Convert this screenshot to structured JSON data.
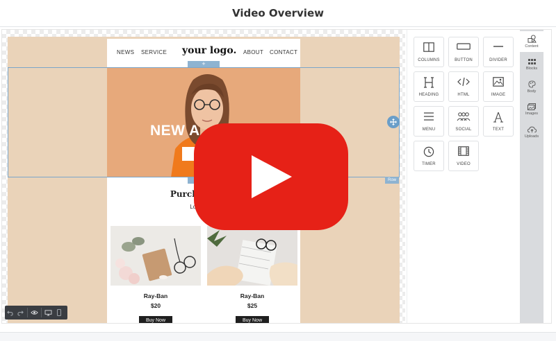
{
  "header": {
    "title": "Video Overview"
  },
  "email": {
    "nav": {
      "left": [
        "NEWS",
        "SERVICE"
      ],
      "logo": "your logo.",
      "right": [
        "ABOUT",
        "CONTACT"
      ]
    },
    "hero": {
      "title": "NEW A",
      "button": "VI"
    },
    "section": {
      "title": "Purchasing Fo",
      "subtitle": "Lorem ipsu"
    },
    "products": [
      {
        "name": "Ray-Ban",
        "price": "$20",
        "button": "Buy Now"
      },
      {
        "name": "Ray-Ban",
        "price": "$25",
        "button": "Buy Now"
      }
    ]
  },
  "editor": {
    "add_symbol": "+",
    "row_label": "Row"
  },
  "tools": [
    {
      "label": "COLUMNS",
      "icon": "columns-icon"
    },
    {
      "label": "BUTTON",
      "icon": "button-icon"
    },
    {
      "label": "DIVIDER",
      "icon": "divider-icon"
    },
    {
      "label": "HEADING",
      "icon": "heading-icon"
    },
    {
      "label": "HTML",
      "icon": "code-icon"
    },
    {
      "label": "IMAGE",
      "icon": "image-icon"
    },
    {
      "label": "MENU",
      "icon": "menu-icon"
    },
    {
      "label": "SOCIAL",
      "icon": "social-icon"
    },
    {
      "label": "TEXT",
      "icon": "text-icon"
    },
    {
      "label": "TIMER",
      "icon": "clock-icon"
    },
    {
      "label": "VIDEO",
      "icon": "film-icon"
    }
  ],
  "sidebar": [
    {
      "label": "Content",
      "icon": "shapes-icon",
      "active": true
    },
    {
      "label": "Blocks",
      "icon": "grid-icon"
    },
    {
      "label": "Body",
      "icon": "palette-icon"
    },
    {
      "label": "Images",
      "icon": "images-icon"
    },
    {
      "label": "Uploads",
      "icon": "cloud-upload-icon"
    }
  ],
  "colors": {
    "accent": "#6a9ec9",
    "play": "#e62117",
    "canvas_bg": "#ead3b9",
    "hero_bg": "#e7a97b"
  }
}
